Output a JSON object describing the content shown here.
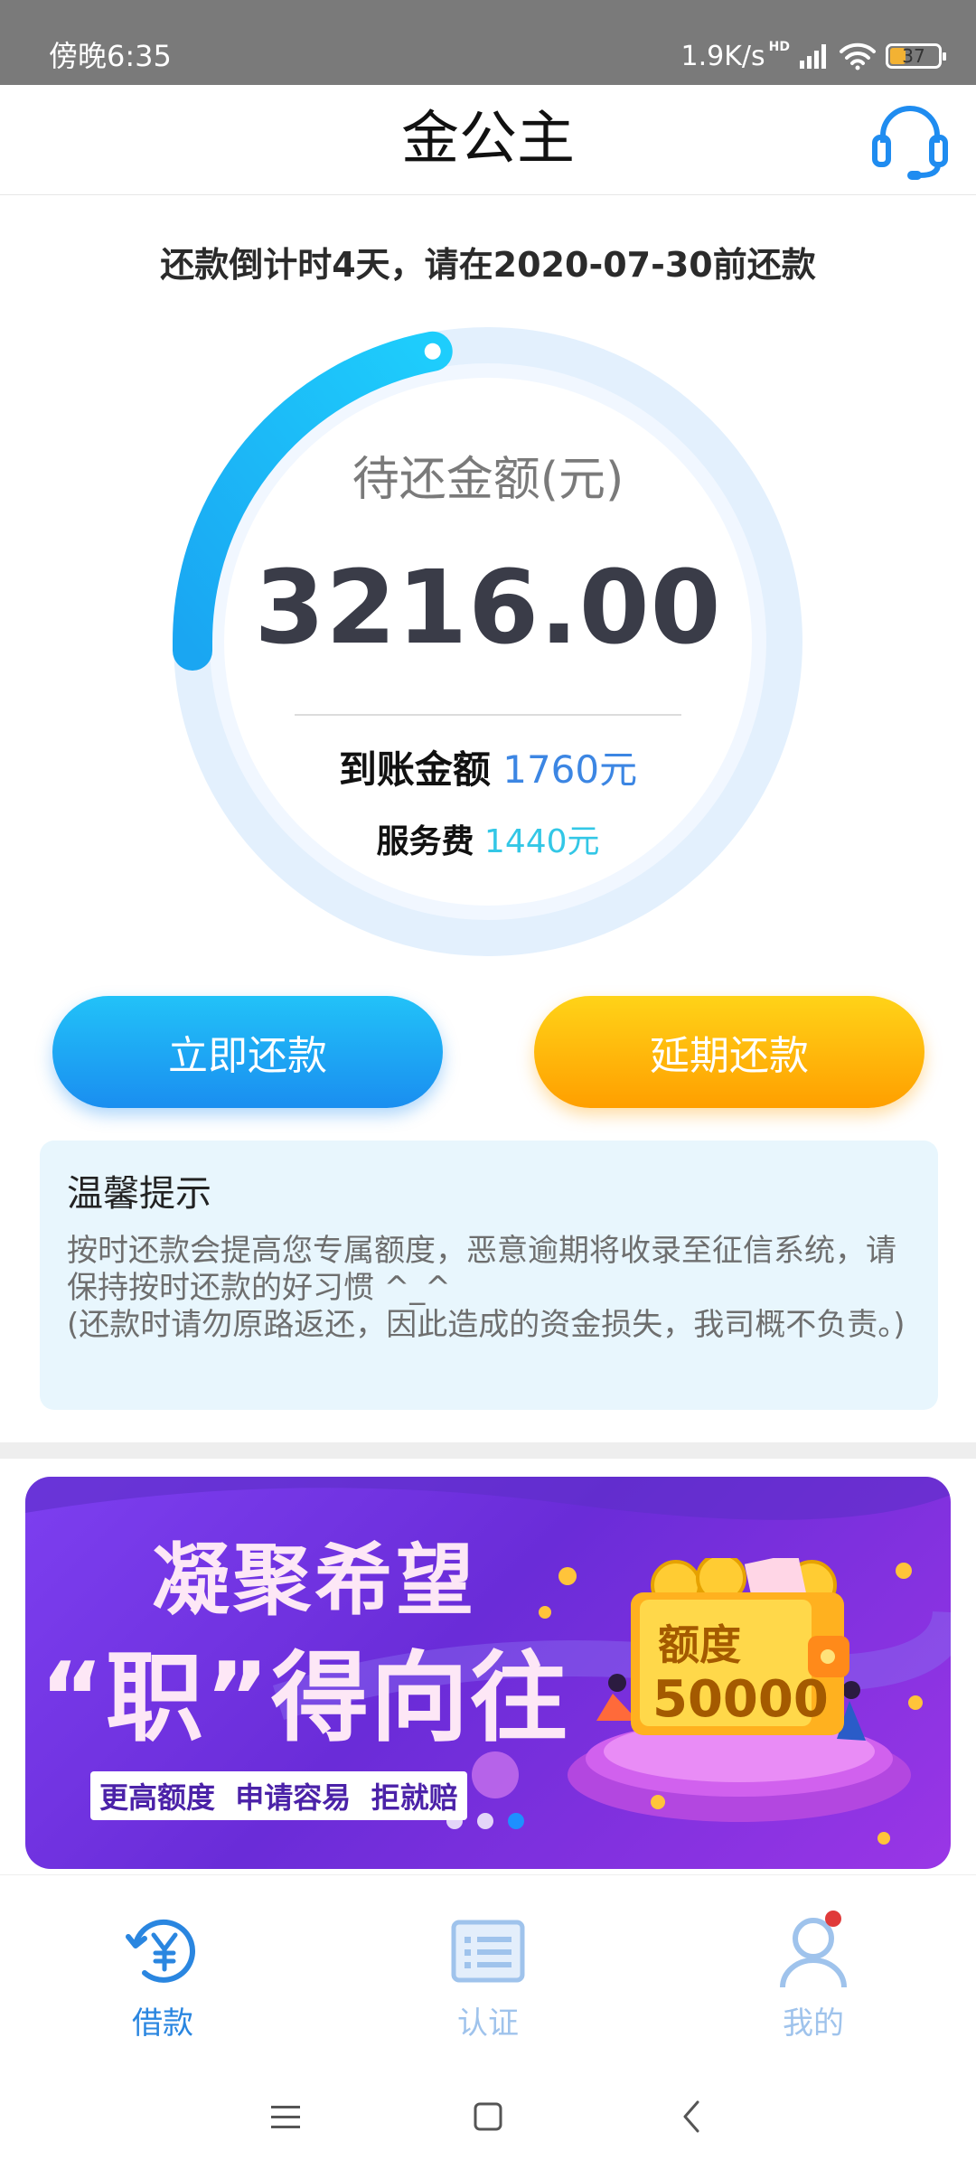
{
  "status_bar": {
    "time": "傍晚6:35",
    "net_speed": "1.9K/s",
    "hd": "HD",
    "battery": "37",
    "battery_level": 0.37
  },
  "header": {
    "title": "金公主",
    "support_icon": "headset-icon"
  },
  "repayment": {
    "countdown": "还款倒计时4天，请在2020-07-30前还款",
    "amount_label": "待还金额(元)",
    "amount_value": "3216.00",
    "received_label": "到账金额",
    "received_value": "1760元",
    "fee_label": "服务费",
    "fee_value": "1440元",
    "ring_progress": 0.22,
    "colors": {
      "ring_active": "#19b4f5",
      "ring_track": "#e3f0fd",
      "received": "#3c86e3",
      "fee": "#33c7e6"
    }
  },
  "actions": {
    "repay_now": "立即还款",
    "extend": "延期还款"
  },
  "tips": {
    "title": "温馨提示",
    "body": "按时还款会提高您专属额度，恶意逾期将收录至征信系统，请保持按时还款的好习惯 ^_^\n(还款时请勿原路返还，因此造成的资金损失，我司概不负责。)"
  },
  "banner": {
    "line1": "凝聚希望",
    "line2": "“职”得向往",
    "tags": "更高额度  申请容易  拒就赔",
    "wallet_label": "额度",
    "wallet_amount": "50000",
    "slides": 3,
    "active_slide": 3
  },
  "tabbar": {
    "items": [
      {
        "label": "借款",
        "icon": "loan-yen-icon",
        "active": true
      },
      {
        "label": "认证",
        "icon": "verify-list-icon",
        "active": false
      },
      {
        "label": "我的",
        "icon": "profile-icon",
        "active": false
      }
    ],
    "active_color": "#2a86e0",
    "inactive_color": "#9fc3ec"
  },
  "navbar": {
    "buttons": [
      "menu-icon",
      "home-icon",
      "back-icon"
    ]
  }
}
